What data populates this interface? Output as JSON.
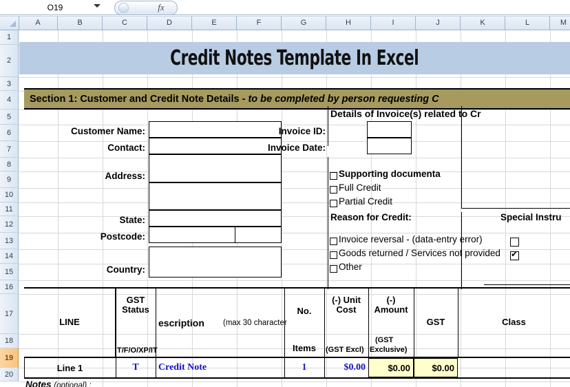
{
  "app": {
    "name_box_value": "O19",
    "fx_label": "fx"
  },
  "grid": {
    "columns": [
      "A",
      "B",
      "C",
      "D",
      "E",
      "F",
      "G",
      "H",
      "I",
      "J",
      "K",
      "L",
      "M"
    ],
    "rows": [
      "1",
      "2",
      "3",
      "4",
      "5",
      "6",
      "7",
      "8",
      "9",
      "10",
      "11",
      "12",
      "13",
      "14",
      "15",
      "16",
      "17",
      "18",
      "19",
      "20"
    ],
    "selected_row": "19"
  },
  "sheet": {
    "title": "Credit Notes Template In Excel",
    "section1_prefix": "Section 1:  Customer and Credit Note Details - ",
    "section1_italic": "to be completed by person requesting C",
    "invoice_section_heading": "Details of Invoice(s) related to Cr",
    "customer_labels": {
      "name": "Customer Name:",
      "contact": "Contact:",
      "address": "Address:",
      "state": "State:",
      "postcode": "Postcode:",
      "country": "Country:"
    },
    "customer_values": {
      "name": "",
      "contact": "",
      "address": "",
      "state": "",
      "postcode": "",
      "country": ""
    },
    "invoice_labels": {
      "id": "Invoice ID:",
      "date": "Invoice Date:"
    },
    "invoice_values": {
      "id": "",
      "date": ""
    },
    "credit_type_checkboxes": [
      {
        "label": "Supporting documenta",
        "checked": false,
        "bold": true
      },
      {
        "label": "Full Credit",
        "checked": false,
        "bold": false
      },
      {
        "label": "Partial Credit",
        "checked": false,
        "bold": false
      }
    ],
    "reason_heading": "Reason for Credit:",
    "special_instructions_heading": "Special Instru",
    "reason_checkboxes": [
      {
        "label": "Invoice reversal - (data-entry error)",
        "checked": false
      },
      {
        "label": "Goods returned / Services not provided",
        "checked": false
      },
      {
        "label": "Other",
        "checked": false
      }
    ],
    "overlay_checkboxes": [
      {
        "checked": false
      },
      {
        "checked": true
      }
    ],
    "table": {
      "headers": {
        "line": "LINE",
        "gst_status": "GST",
        "gst_status2": "Status",
        "gst_status_sub": "T/F/O/XP/IT",
        "description": "escription",
        "description_note": "(max 30 character",
        "no": "No.",
        "items": "Items",
        "unit_cost": "(-) Unit",
        "unit_cost2": "Cost",
        "unit_cost_sub": "(GST Excl)",
        "amount": "(-)",
        "amount2": "Amount",
        "amount_sub": "(GST",
        "amount_sub2": "Exclusive)",
        "gst": "GST",
        "class": "Class"
      },
      "rows": [
        {
          "line": "Line 1",
          "gst_status": "T",
          "description": "Credit Note",
          "items": "1",
          "unit_cost": "$0.00",
          "amount": "$0.00",
          "gst": "$0.00",
          "class": ""
        }
      ]
    },
    "notes_label": "Notes",
    "notes_optional": "(optional) :"
  },
  "colors": {
    "title_band": "#b8cce4",
    "section_band": "#a69a5e",
    "formula_cell": "#ffffcc",
    "blue_text": "#1414c8",
    "selected_row_header": "#f8c583"
  }
}
